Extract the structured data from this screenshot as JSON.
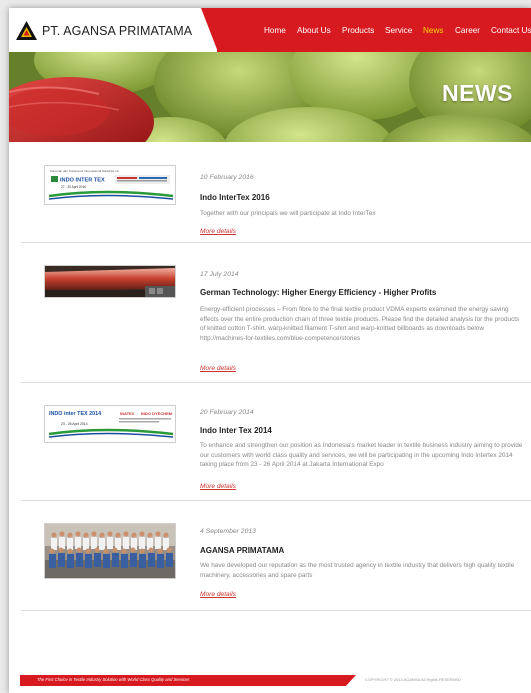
{
  "brand": {
    "name": "PT. AGANSA PRIMATAMA",
    "accent": "#d71a20",
    "active_nav": "#f5d700"
  },
  "nav": {
    "items": [
      {
        "label": "Home"
      },
      {
        "label": "About Us"
      },
      {
        "label": "Products"
      },
      {
        "label": "Service"
      },
      {
        "label": "News"
      },
      {
        "label": "Career"
      },
      {
        "label": "Contact Us"
      }
    ],
    "active_label": "News"
  },
  "banner": {
    "title": "NEWS"
  },
  "news": [
    {
      "date": "10 February 2016",
      "title": "Indo InterTex 2016",
      "body": "Together with our principals we will participate at Indo InterTex",
      "more": "More details",
      "thumb": {
        "logo_text": "INDO INTER TEX",
        "caption": "27 - 30 April 2016",
        "top_text": "Pameran dan Konferensi Internasional Tekstil ke 13"
      }
    },
    {
      "date": "17 July 2014",
      "title": "German Technology: Higher Energy Efficiency - Higher Profits",
      "body": "Energy-efficient processes – From fibre to the final textile product VDMA experts examined the energy saving effects over the entire production chain of three textile products. Please find the detailed analysis for the products of knitted cotton T-shirt, warp-knitted filament T-shirt and warp-knitted billboards as downloads below http://machines-for-textiles.com/blue-competence/stories",
      "more": "More details"
    },
    {
      "date": "20 February 2014",
      "title": "Indo Inter Tex 2014",
      "body": "To enhance and strengthen our position as Indonesia's market leader in textile business industry aiming to provide our customers with world class quality and services, we will be participating in the upcoming Indo Intertex 2014 taking place from 23 - 26 April 2014 at Jakarta International Expo",
      "more": "More details",
      "thumb": {
        "logo_text": "INDO inter TEX 2014",
        "caption": "23 - 26 April 2014",
        "tag1": "INATEX",
        "tag2": "INDO DYECHEM"
      }
    },
    {
      "date": "4 September 2013",
      "title": "AGANSA PRIMATAMA",
      "body": "We have developed our reputation as the most trusted agency in textile industry that delivers high quality textile machinery, accessories and spare parts",
      "more": "More details"
    }
  ],
  "footer": {
    "tagline": "The First Choice in Textile Industry Solution with World Class Quality and Services",
    "copyright": "COPYRIGHT © 2013 AGANSA All Rights RESERVED"
  }
}
